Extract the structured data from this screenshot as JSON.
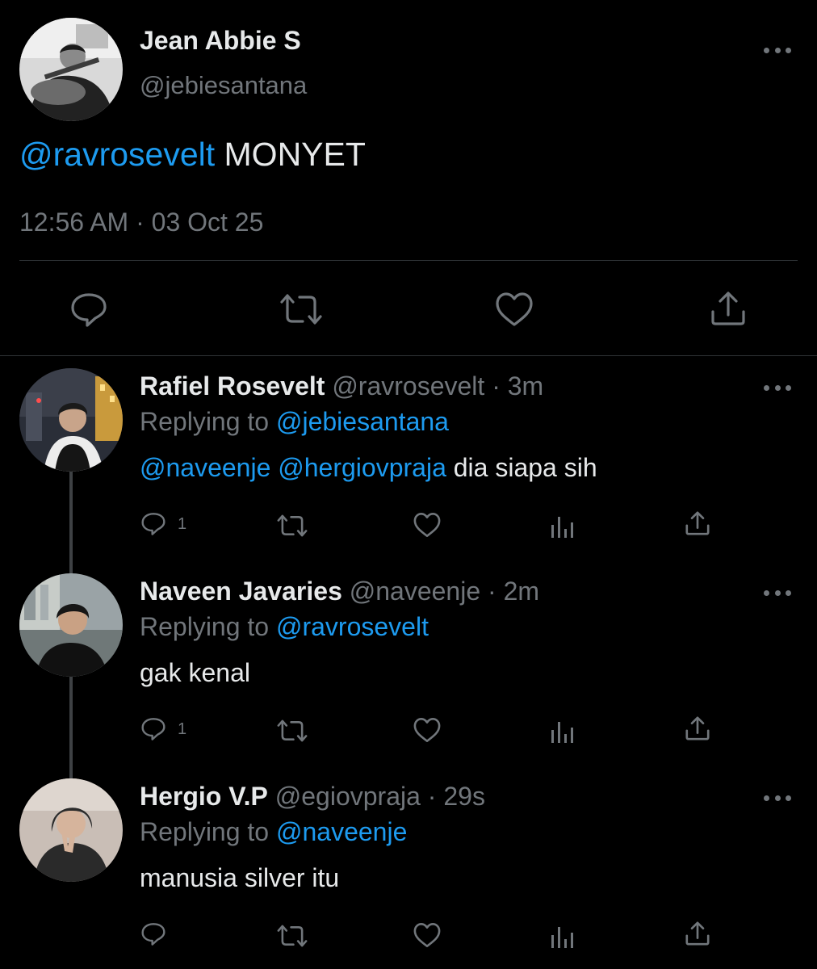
{
  "main_tweet": {
    "author_name": "Jean Abbie S",
    "author_handle": "@jebiesantana",
    "mention": "@ravrosevelt",
    "text": " MONYET",
    "timestamp": "12:56 AM · 03 Oct 25",
    "actions": [
      "reply-icon",
      "retweet-icon",
      "like-icon",
      "share-icon"
    ]
  },
  "replies": [
    {
      "author_name": "Rafiel Rosevelt",
      "meta": " @ravrosevelt · 3m",
      "replying_prefix": "Replying to ",
      "replying_to": "@jebiesantana",
      "mention1": "@naveenje",
      "mention2": "@hergiovpraja",
      "text": " dia siapa sih",
      "reply_count": "1"
    },
    {
      "author_name": "Naveen Javaries",
      "meta": " @naveenje · 2m",
      "replying_prefix": "Replying to ",
      "replying_to": "@ravrosevelt",
      "text": "gak kenal",
      "reply_count": "1"
    },
    {
      "author_name": "Hergio V.P",
      "meta": " @egiovpraja · 29s",
      "replying_prefix": "Replying to ",
      "replying_to": "@naveenje",
      "text": "manusia silver itu",
      "reply_count": ""
    }
  ],
  "colors": {
    "background": "#000000",
    "text": "#e7e9ea",
    "muted": "#71767b",
    "link": "#1d9bf0",
    "divider": "#2f3336"
  }
}
